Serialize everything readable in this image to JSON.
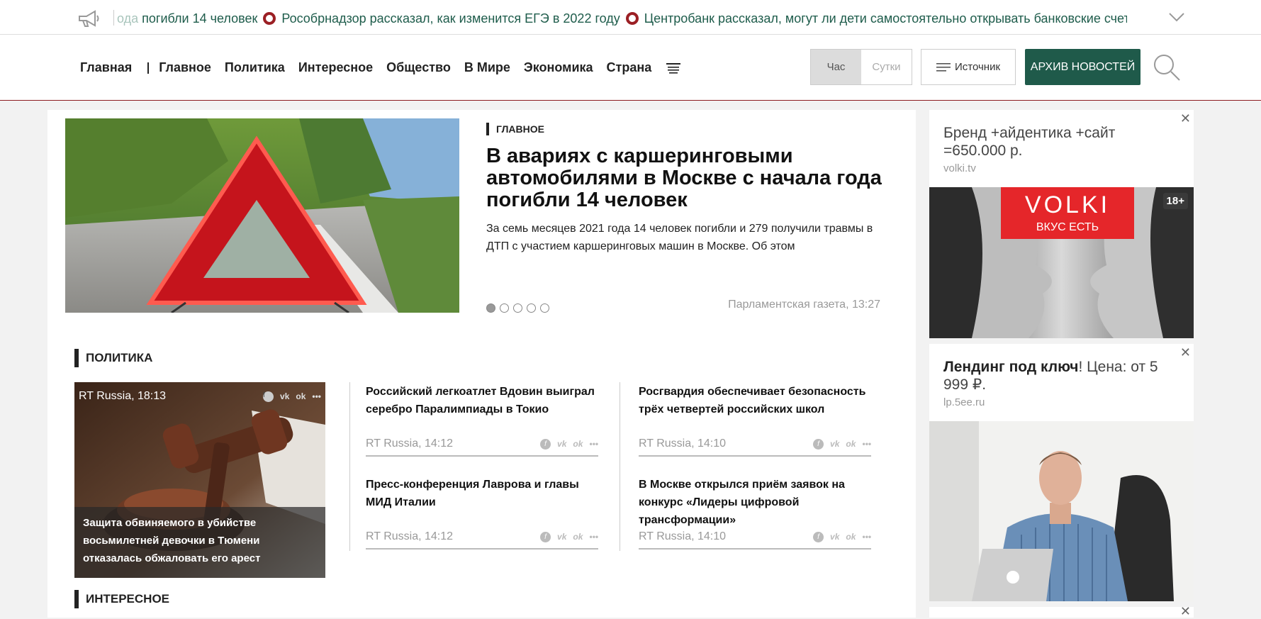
{
  "ticker": {
    "fade_text": "ода ",
    "items": [
      "погибли 14 человек",
      "Рособрнадзор рассказал, как изменится ЕГЭ в 2022 году",
      "Центробанк рассказал, могут ли дети самостоятельно открывать банковские счета"
    ]
  },
  "nav": {
    "home": "Главная",
    "items": [
      "Главное",
      "Политика",
      "Интересное",
      "Общество",
      "В Мире",
      "Экономика",
      "Страна"
    ]
  },
  "period": {
    "hour": "Час",
    "day": "Сутки",
    "selected": "Час"
  },
  "source_btn": "Источник",
  "archive_btn": "АРХИВ НОВОСТЕЙ",
  "hero": {
    "tag": "ГЛАВНОЕ",
    "title": "В авариях с каршеринговыми автомобилями в Москве с начала года погибли 14 человек",
    "lead": "За семь месяцев 2021 года 14 человек погибли и 279 получили травмы в ДТП с участием каршеринговых машин в Москве. Об этом",
    "source": "Парламентская газета, 13:27",
    "slides": 5,
    "active_slide": 1
  },
  "politics": {
    "title": "ПОЛИТИКА",
    "featured": {
      "source": "RT Russia, 18:13",
      "caption": "Защита обвиняемого в убийстве восьмилетней девочки в Тюмени отказалась обжаловать его арест"
    },
    "articles": [
      {
        "title": "Российский легкоатлет Вдовин выиграл серебро Паралимпиады в Токио",
        "meta": "RT Russia, 14:12"
      },
      {
        "title": "Росгвардия обеспечивает безопасность трёх четвертей российских школ",
        "meta": "RT Russia, 14:10"
      },
      {
        "title": "Пресс-конференция Лаврова и главы МИД Италии",
        "meta": "RT Russia, 14:12"
      },
      {
        "title": "В Москве открылся приём заявок на конкурс «Лидеры цифровой трансформации»",
        "meta": "RT Russia, 14:10"
      }
    ]
  },
  "interesting": {
    "title": "ИНТЕРЕСНОЕ"
  },
  "ads": [
    {
      "text": "Бренд +айдентика +сайт =650.000 р.",
      "domain": "volki.tv",
      "banner_brand": "VOLKI",
      "banner_slogan": "ВКУС ЕСТЬ",
      "age": "18+"
    },
    {
      "text_bold": "Лендинг под ключ",
      "text_rest": "! Цена: от 5 999 ₽.",
      "domain": "lp.5ee.ru"
    }
  ],
  "colors": {
    "accent": "#1f5a4a",
    "brand_red": "#9b1f24",
    "ad_red": "#e5262a"
  }
}
